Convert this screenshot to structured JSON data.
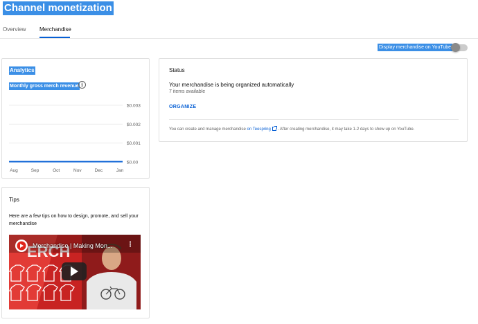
{
  "page": {
    "title": "Channel monetization"
  },
  "tabs": [
    {
      "label": "Overview"
    },
    {
      "label": "Merchandise"
    }
  ],
  "toggle": {
    "label": "Display merchandise on YouTube",
    "state": "off"
  },
  "analytics": {
    "title": "Analytics",
    "subtitle": "Monthly gross merch revenue",
    "info_icon": "info-icon"
  },
  "chart_data": {
    "type": "line",
    "title": "Monthly gross merch revenue",
    "categories": [
      "Aug",
      "Sep",
      "Oct",
      "Nov",
      "Dec",
      "Jan"
    ],
    "y_ticks": [
      "$0.00",
      "$0.001",
      "$0.002",
      "$0.003"
    ],
    "ylim": [
      0,
      0.003
    ],
    "series": [
      {
        "values": [
          0,
          0,
          0,
          0,
          0,
          0
        ]
      }
    ],
    "grid": true,
    "color": "#065fd4"
  },
  "status": {
    "title": "Status",
    "message": "Your merchandise is being organized automatically",
    "count": "7 items available",
    "organize_label": "ORGANIZE",
    "note_before": "You can create and manage merchandise",
    "note_link": "on Teespring",
    "note_after": ". After creating merchandise, it may take 1-2 days to show up on YouTube."
  },
  "tips": {
    "title": "Tips",
    "text": "Here are a few tips on how to design, promote, and sell your merchandise",
    "video_title": "Merchandise | Making Mon...",
    "video_menu": "⋮"
  },
  "colors": {
    "accent": "#065fd4",
    "selection": "#3b8fe6",
    "video_red": "#c82322"
  }
}
